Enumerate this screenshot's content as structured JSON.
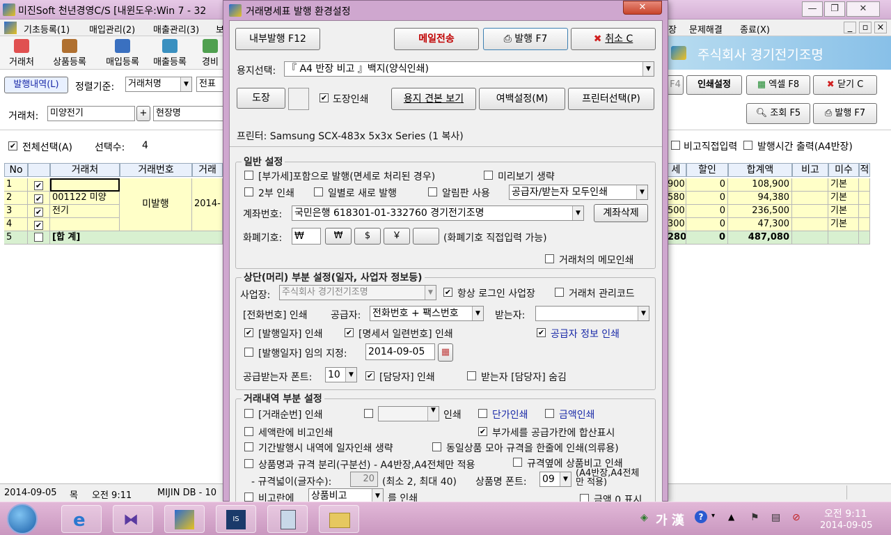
{
  "main": {
    "title": "미진Soft 천년경영C/S [내윈도우:Win 7 - 32",
    "menu": [
      "기초등록(1)",
      "매입관리(2)",
      "매출관리(3)",
      "보"
    ],
    "menu_right": [
      "장",
      "문제해결",
      "종료(X)"
    ],
    "toolbar": [
      "거래처",
      "상품등록",
      "매입등록",
      "매출등록",
      "경비"
    ],
    "company_banner": "주식회사 경기전기조명",
    "tab_issue_list": "발행내역(L)",
    "sort_label": "정렬기준:",
    "sort_value": "거래처명",
    "sort_value2": "전표",
    "client_label": "거래처:",
    "client_value": "미양전기",
    "plus": "+",
    "site_value": "현장명",
    "select_all": "전체선택(A)",
    "selected_count_label": "선택수:",
    "selected_count": "4",
    "buttons_right": {
      "f4": "F4",
      "print_settings": "인쇄설정",
      "excel": "엑셀 F8",
      "close": "닫기 C",
      "search": "조회 F5",
      "issue": "발행 F7"
    },
    "options_right": {
      "memo_direct": "비고직접입력",
      "issue_time": "발행시간 출력(A4반장)"
    },
    "grid_headers_left": [
      "No",
      "",
      "거래처",
      "거래번호",
      "거래"
    ],
    "grid_headers_right": [
      "세",
      "할인",
      "합계액",
      "비고",
      "미수",
      "적"
    ],
    "rows": [
      {
        "no": "1",
        "checked": true,
        "client": "",
        "tax": "900",
        "discount": "0",
        "total": "108,900",
        "misu": "기본"
      },
      {
        "no": "2",
        "checked": true,
        "client": "001122 미양",
        "tax": "580",
        "discount": "0",
        "total": "94,380",
        "misu": "기본"
      },
      {
        "no": "3",
        "checked": true,
        "client": "전기",
        "tax": "500",
        "discount": "0",
        "total": "236,500",
        "misu": "기본"
      },
      {
        "no": "4",
        "checked": true,
        "client": "",
        "tax": "300",
        "discount": "0",
        "total": "47,300",
        "misu": "기본"
      }
    ],
    "merged_status": "미발행",
    "merged_date": "2014-",
    "total_row": {
      "no": "5",
      "label": "[합 계]",
      "tax": "280",
      "discount": "0",
      "total": "487,080"
    },
    "status": {
      "date": "2014-09-05",
      "weekday": "목",
      "time": "오전 9:11",
      "db": "MIJIN DB - 10"
    }
  },
  "dialog": {
    "title": "거래명세표 발행 환경설정",
    "close_icon": "✕",
    "internal_issue": "내부발행 F12",
    "email_send": "메일전송",
    "issue": "발행 F7",
    "cancel": "취소 C",
    "paper_label": "용지선택:",
    "paper_value": "『 A4 반장 비고 』백지(양식인쇄)",
    "stamp_btn": "도장",
    "stamp_print": "도장인쇄",
    "paper_preview": "용지 견본 보기",
    "margin_btn": "여백설정(M)",
    "printer_btn": "프린터선택(P)",
    "printer_text": "프린터: Samsung SCX-483x 5x3x Series (1 복사)",
    "general": {
      "title": "일반 설정",
      "vat_included": "[부가세]포함으로 발행(면세로 처리된 경우)",
      "skip_preview": "미리보기 생략",
      "two_copies": "2부 인쇄",
      "daily_new": "일별로 새로 발행",
      "notice_use": "알림판 사용",
      "both_print": "공급자/받는자 모두인쇄",
      "account_label": "계좌번호:",
      "account_value": "국민은행 618301-01-332760 경기전기조명",
      "account_delete": "계좌삭제",
      "currency_label": "화폐기호:",
      "currency_value": "₩",
      "currency_buttons": [
        "₩",
        "$",
        "￥",
        ""
      ],
      "currency_note": "(화폐기호 직접입력 가능)",
      "client_memo": "거래처의 메모인쇄"
    },
    "header": {
      "title": "상단(머리) 부분 설정(일자, 사업자 정보등)",
      "biz_label": "사업장:",
      "biz_value": "주식회사 경기전기조명",
      "always_logo": "항상 로그인 사업장",
      "client_code": "거래처 관리코드",
      "phone_print": "[전화번호] 인쇄",
      "supplier_label": "공급자:",
      "supplier_value": "전화번호 + 팩스번호",
      "receiver_label": "받는자:",
      "receiver_value": "",
      "issue_date_print": "[발행일자] 인쇄",
      "serial_print": "[명세서 일련번호] 인쇄",
      "supplier_info": "공급자 정보 인쇄",
      "date_custom": "[발행일자] 임의 지정:",
      "date_value": "2014-09-05",
      "font_label": "공급받는자 폰트:",
      "font_value": "10",
      "manager_print": "[담당자] 인쇄",
      "hide_receiver_manager": "받는자 [담당자] 숨김"
    },
    "detail": {
      "title": "거래내역 부분 설정",
      "seq_print": "[거래순번] 인쇄",
      "print_suffix": "인쇄",
      "unit_price_print": "단가인쇄",
      "amount_print": "금액인쇄",
      "tax_in_memo": "세액란에 비고인쇄",
      "vat_summed": "부가세를 공급가칸에 합산표시",
      "skip_date": "기간발행시 내역에 일자인쇄 생략",
      "same_item": "동일상품 모아 규격을 한줄에 인쇄(의류용)",
      "split_name": "상품명과 규격 분리(구분선) - A4반장,A4전체만 적용",
      "spec_memo": "규격옆에 상품비고 인쇄",
      "spec_width_label": "- 규격넓이(글자수):",
      "spec_width_value": "20",
      "spec_width_note": "(최소 2, 최대 40)",
      "item_font_label": "상품명 폰트:",
      "item_font_value": "09",
      "item_font_note": "(A4반장,A4전체만 적용)",
      "memo_col": "비고란에",
      "memo_col_value": "상품비고",
      "memo_col_suffix": "를 인쇄",
      "zero_amount": "금액 0 표시"
    }
  },
  "taskbar": {
    "ime": "가 漢",
    "time": "오전 9:11",
    "date": "2014-09-05"
  },
  "colors": {
    "title_bg": "#d8b4d8",
    "grid_yellow": "#ffffc8",
    "total_row": "#d8f0d0",
    "blue_text": "#1a2aa8",
    "red_text": "#c00000"
  }
}
